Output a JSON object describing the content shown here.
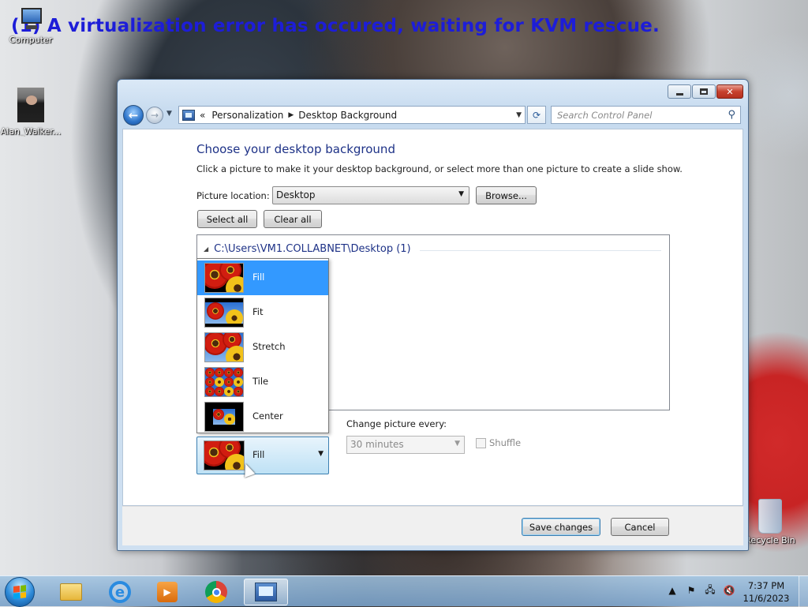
{
  "overlay": {
    "kvm_error": "(1) A virtualization error has occured, waiting for KVM rescue."
  },
  "desktop": {
    "icons": [
      {
        "label": "Computer"
      },
      {
        "label": "Alan_Walker..."
      },
      {
        "label": "Recycle Bin"
      }
    ]
  },
  "window": {
    "address": {
      "crumbs": [
        "Personalization",
        "Desktop Background"
      ],
      "prefix": "«"
    },
    "search_placeholder": "Search Control Panel",
    "heading": "Choose your desktop background",
    "subtext": "Click a picture to make it your desktop background, or select more than one picture to create a slide show.",
    "picture_location_label": "Picture location:",
    "picture_location_value": "Desktop",
    "browse_label": "Browse...",
    "select_all_label": "Select all",
    "clear_all_label": "Clear all",
    "group_header": "C:\\Users\\VM1.COLLABNET\\Desktop (1)",
    "picture_position": {
      "options": [
        "Fill",
        "Fit",
        "Stretch",
        "Tile",
        "Center"
      ],
      "selected": "Fill"
    },
    "change_picture_label": "Change picture every:",
    "interval_value": "30 minutes",
    "shuffle_label": "Shuffle",
    "save_label": "Save changes",
    "cancel_label": "Cancel"
  },
  "taskbar": {
    "clock_time": "7:37 PM",
    "clock_date": "11/6/2023"
  },
  "colors": {
    "heading": "#1e3287",
    "selection": "#3399ff",
    "overlay_text": "#1d1dd8"
  }
}
